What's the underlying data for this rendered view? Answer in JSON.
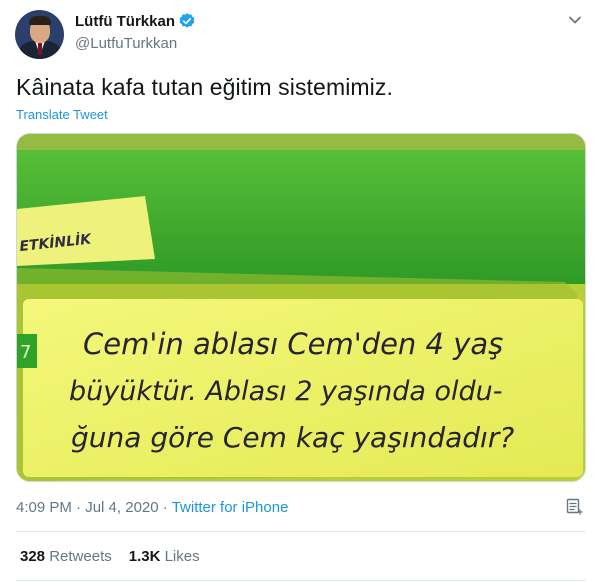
{
  "author": {
    "display_name": "Lütfü Türkkan",
    "handle": "@LutfuTurkkan",
    "verified_icon": "verified-badge-icon"
  },
  "tweet": {
    "text": "Kâinata kafa tutan eğitim sistemimiz.",
    "translate_label": "Translate Tweet"
  },
  "media": {
    "tab_label": "ETKİNLİK",
    "question_number": "7",
    "lines": [
      "Cem'in ablası Cem'den 4 yaş",
      "büyüktür. Ablası 2 yaşında oldu-",
      "ğuna göre Cem kaç yaşındadır?"
    ]
  },
  "meta": {
    "time": "4:09 PM",
    "separator": "·",
    "date": "Jul 4, 2020",
    "source": "Twitter for iPhone"
  },
  "stats": {
    "retweets_count": "328",
    "retweets_label": "Retweets",
    "likes_count": "1.3K",
    "likes_label": "Likes"
  },
  "colors": {
    "accent": "#1b95e0",
    "secondary_text": "#657786",
    "photo_green": "#3aa52a",
    "photo_yellow": "#eef06a"
  }
}
